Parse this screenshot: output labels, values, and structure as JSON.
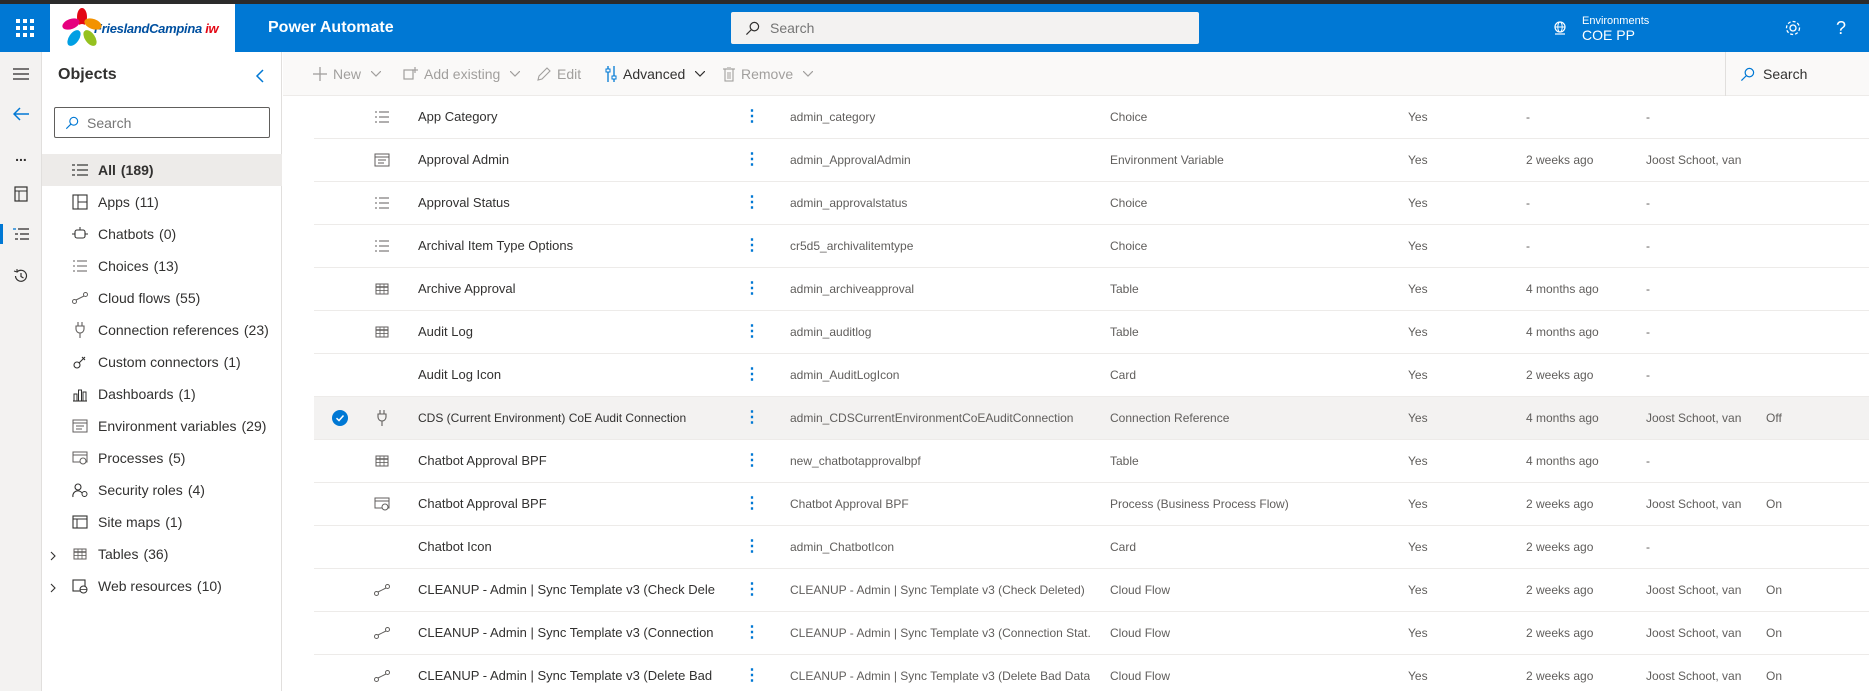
{
  "header": {
    "app_title": "Power Automate",
    "search_placeholder": "Search",
    "environment_label": "Environments",
    "environment_name": "COE PP",
    "logo_text_main": "FrieslandCampina",
    "logo_text_accent": "iw"
  },
  "objects_pane": {
    "title": "Objects",
    "search_placeholder": "Search",
    "items": [
      {
        "label": "All",
        "count": "(189)",
        "icon": "list-icon"
      },
      {
        "label": "Apps",
        "count": "(11)",
        "icon": "apps-icon"
      },
      {
        "label": "Chatbots",
        "count": "(0)",
        "icon": "chatbot-icon"
      },
      {
        "label": "Choices",
        "count": "(13)",
        "icon": "choices-icon"
      },
      {
        "label": "Cloud flows",
        "count": "(55)",
        "icon": "flow-icon"
      },
      {
        "label": "Connection references",
        "count": "(23)",
        "icon": "plug-icon"
      },
      {
        "label": "Custom connectors",
        "count": "(1)",
        "icon": "connector-icon"
      },
      {
        "label": "Dashboards",
        "count": "(1)",
        "icon": "dashboard-icon"
      },
      {
        "label": "Environment variables",
        "count": "(29)",
        "icon": "env-variable-icon"
      },
      {
        "label": "Processes",
        "count": "(5)",
        "icon": "process-icon"
      },
      {
        "label": "Security roles",
        "count": "(4)",
        "icon": "security-role-icon"
      },
      {
        "label": "Site maps",
        "count": "(1)",
        "icon": "sitemap-icon"
      },
      {
        "label": "Tables",
        "count": "(36)",
        "icon": "table-icon"
      },
      {
        "label": "Web resources",
        "count": "(10)",
        "icon": "web-resource-icon"
      }
    ]
  },
  "toolbar": {
    "new_label": "New",
    "add_existing_label": "Add existing",
    "edit_label": "Edit",
    "advanced_label": "Advanced",
    "remove_label": "Remove",
    "search_label": "Search"
  },
  "grid": {
    "more_glyph": "⋮",
    "rows": [
      {
        "name": "App Category",
        "system_name": "admin_category",
        "type": "Choice",
        "managed": "Yes",
        "modified": "-",
        "owner": "-",
        "status": "",
        "icon": "choices-icon",
        "selected": false
      },
      {
        "name": "Approval Admin",
        "system_name": "admin_ApprovalAdmin",
        "type": "Environment Variable",
        "managed": "Yes",
        "modified": "2 weeks ago",
        "owner": "Joost Schoot, van",
        "status": "",
        "icon": "env-variable-icon",
        "selected": false
      },
      {
        "name": "Approval Status",
        "system_name": "admin_approvalstatus",
        "type": "Choice",
        "managed": "Yes",
        "modified": "-",
        "owner": "-",
        "status": "",
        "icon": "choices-icon",
        "selected": false
      },
      {
        "name": "Archival Item Type Options",
        "system_name": "cr5d5_archivalitemtype",
        "type": "Choice",
        "managed": "Yes",
        "modified": "-",
        "owner": "-",
        "status": "",
        "icon": "choices-icon",
        "selected": false
      },
      {
        "name": "Archive Approval",
        "system_name": "admin_archiveapproval",
        "type": "Table",
        "managed": "Yes",
        "modified": "4 months ago",
        "owner": "-",
        "status": "",
        "icon": "table-icon",
        "selected": false
      },
      {
        "name": "Audit Log",
        "system_name": "admin_auditlog",
        "type": "Table",
        "managed": "Yes",
        "modified": "4 months ago",
        "owner": "-",
        "status": "",
        "icon": "table-icon",
        "selected": false
      },
      {
        "name": "Audit Log Icon",
        "system_name": "admin_AuditLogIcon",
        "type": "Card",
        "managed": "Yes",
        "modified": "2 weeks ago",
        "owner": "-",
        "status": "",
        "icon": "",
        "selected": false
      },
      {
        "name": "CDS (Current Environment) CoE Audit Connection",
        "system_name": "admin_CDSCurrentEnvironmentCoEAuditConnection",
        "type": "Connection Reference",
        "managed": "Yes",
        "modified": "4 months ago",
        "owner": "Joost Schoot, van",
        "status": "Off",
        "icon": "plug-icon",
        "selected": true
      },
      {
        "name": "Chatbot Approval BPF",
        "system_name": "new_chatbotapprovalbpf",
        "type": "Table",
        "managed": "Yes",
        "modified": "4 months ago",
        "owner": "-",
        "status": "",
        "icon": "table-icon",
        "selected": false
      },
      {
        "name": "Chatbot Approval BPF",
        "system_name": "Chatbot Approval BPF",
        "type": "Process (Business Process Flow)",
        "managed": "Yes",
        "modified": "2 weeks ago",
        "owner": "Joost Schoot, van",
        "status": "On",
        "icon": "process-icon",
        "selected": false
      },
      {
        "name": "Chatbot Icon",
        "system_name": "admin_ChatbotIcon",
        "type": "Card",
        "managed": "Yes",
        "modified": "2 weeks ago",
        "owner": "-",
        "status": "",
        "icon": "",
        "selected": false
      },
      {
        "name": "CLEANUP - Admin | Sync Template v3 (Check Dele",
        "system_name": "CLEANUP - Admin | Sync Template v3 (Check Deleted)",
        "type": "Cloud Flow",
        "managed": "Yes",
        "modified": "2 weeks ago",
        "owner": "Joost Schoot, van",
        "status": "On",
        "icon": "flow-icon",
        "selected": false
      },
      {
        "name": "CLEANUP - Admin | Sync Template v3 (Connection",
        "system_name": "CLEANUP - Admin | Sync Template v3 (Connection Stat...",
        "type": "Cloud Flow",
        "managed": "Yes",
        "modified": "2 weeks ago",
        "owner": "Joost Schoot, van",
        "status": "On",
        "icon": "flow-icon",
        "selected": false
      },
      {
        "name": "CLEANUP - Admin | Sync Template v3 (Delete Bad",
        "system_name": "CLEANUP - Admin | Sync Template v3 (Delete Bad Data)",
        "type": "Cloud Flow",
        "managed": "Yes",
        "modified": "2 weeks ago",
        "owner": "Joost Schoot, van",
        "status": "On",
        "icon": "flow-icon",
        "selected": false
      }
    ]
  },
  "colors": {
    "header_bg": "#0078d4",
    "accent": "#0078d4",
    "selected_row_bg": "#f3f2f1"
  }
}
